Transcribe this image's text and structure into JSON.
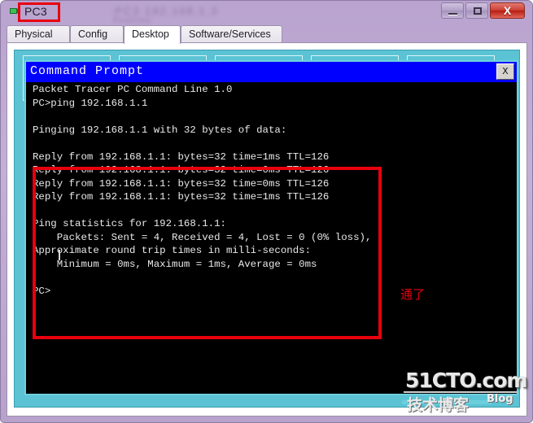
{
  "window": {
    "title": "PC3",
    "blurred_title_text": "PC3 192.168.1.3",
    "blurred_subtitle_text": "Realtime",
    "icon": "device-pc-icon",
    "controls": {
      "minimize": "minimize-icon",
      "maximize": "maximize-icon",
      "close_label": "X"
    }
  },
  "tabs": [
    {
      "label": "Physical",
      "active": false
    },
    {
      "label": "Config",
      "active": false
    },
    {
      "label": "Desktop",
      "active": true
    },
    {
      "label": "Software/Services",
      "active": false
    }
  ],
  "command_prompt": {
    "title": "Command Prompt",
    "close_label": "X",
    "output": "Packet Tracer PC Command Line 1.0\nPC>ping 192.168.1.1\n\nPinging 192.168.1.1 with 32 bytes of data:\n\nReply from 192.168.1.1: bytes=32 time=1ms TTL=126\nReply from 192.168.1.1: bytes=32 time=0ms TTL=126\nReply from 192.168.1.1: bytes=32 time=0ms TTL=126\nReply from 192.168.1.1: bytes=32 time=1ms TTL=126\n\nPing statistics for 192.168.1.1:\n    Packets: Sent = 4, Received = 4, Lost = 0 (0% loss),\nApproximate round trip times in milli-seconds:\n    Minimum = 0ms, Maximum = 1ms, Average = 0ms\n\nPC>",
    "lines": [
      "Packet Tracer PC Command Line 1.0",
      "PC>ping 192.168.1.1",
      "",
      "Pinging 192.168.1.1 with 32 bytes of data:",
      "",
      "Reply from 192.168.1.1: bytes=32 time=1ms TTL=126",
      "Reply from 192.168.1.1: bytes=32 time=0ms TTL=126",
      "Reply from 192.168.1.1: bytes=32 time=0ms TTL=126",
      "Reply from 192.168.1.1: bytes=32 time=1ms TTL=126",
      "",
      "Ping statistics for 192.168.1.1:",
      "    Packets: Sent = 4, Received = 4, Lost = 0 (0% loss),",
      "Approximate round trip times in milli-seconds:",
      "    Minimum = 0ms, Maximum = 1ms, Average = 0ms",
      "",
      "PC>"
    ],
    "ping_target": "192.168.1.1",
    "packet_size_bytes": "32",
    "ttl": "126",
    "sent": "4",
    "received": "4",
    "lost": "0",
    "loss_percent": "0%",
    "min_ms": "0ms",
    "max_ms": "1ms",
    "avg_ms": "0ms"
  },
  "annotation": {
    "text": "通了",
    "color": "#e8000d"
  },
  "watermark": {
    "site": "51CTO.com",
    "chinese": "技术博客",
    "blog": "Blog"
  },
  "colors": {
    "accent_blue": "#0000ff",
    "desktop_cyan": "#5bc3d4",
    "annotation_red": "#e8000d",
    "titlebar_purple": "#b9a3cf",
    "terminal_bg": "#000000"
  }
}
